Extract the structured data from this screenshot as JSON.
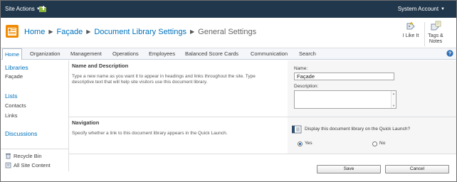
{
  "topbar": {
    "site_actions": "Site Actions",
    "system_account": "System Account"
  },
  "breadcrumb": {
    "items": [
      "Home",
      "Façade",
      "Document Library Settings"
    ],
    "current": "General Settings"
  },
  "social": {
    "like_label": "I Like It",
    "tags_line1": "Tags &",
    "tags_line2": "Notes"
  },
  "topnav": {
    "tabs": [
      "Home",
      "Organization",
      "Management",
      "Operations",
      "Employees",
      "Balanced Score Cards",
      "Communication",
      "Search"
    ]
  },
  "quicklaunch": {
    "libraries": "Libraries",
    "libraries_items": [
      "Façade"
    ],
    "lists": "Lists",
    "lists_items": [
      "Contacts",
      "Links"
    ],
    "discussions": "Discussions",
    "recycle_bin": "Recycle Bin",
    "all_site_content": "All Site Content"
  },
  "form": {
    "name_section": {
      "title": "Name and Description",
      "text": "Type a new name as you want it to appear in headings and links throughout the site. Type descriptive text that will help site visitors use this document library.",
      "name_label": "Name:",
      "name_value": "Façade",
      "description_label": "Description:"
    },
    "nav_section": {
      "title": "Navigation",
      "text": "Specify whether a link to this document library appears in the Quick Launch.",
      "display_label": "Display this document library on the Quick Launch?",
      "yes": "Yes",
      "no": "No",
      "selected": "Yes"
    }
  },
  "buttons": {
    "save": "Save",
    "cancel": "Cancel"
  },
  "colors": {
    "topbar_bg": "#21374c",
    "link": "#0072bc"
  }
}
